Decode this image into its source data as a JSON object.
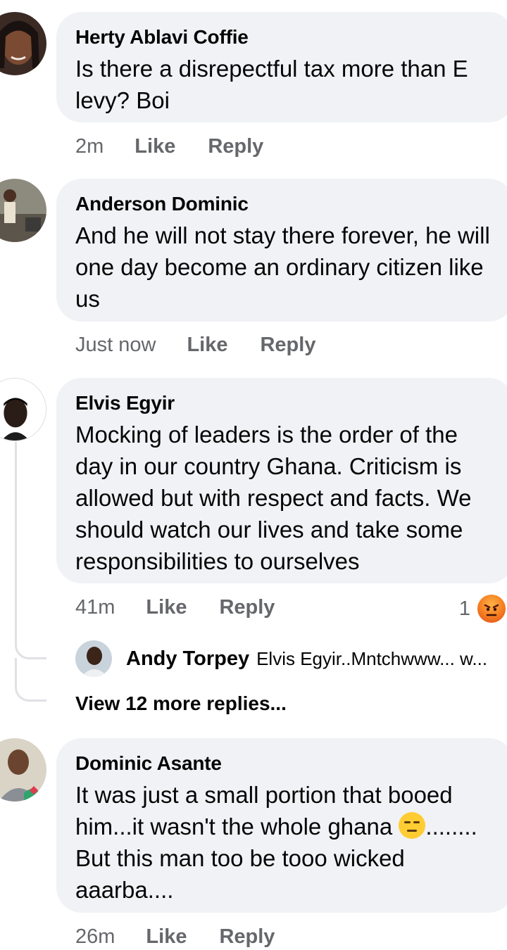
{
  "comments": [
    {
      "author": "Herty Ablavi Coffie",
      "text": "Is there a disrepectful tax more than E levy? Boi",
      "time": "2m",
      "like": "Like",
      "reply": "Reply"
    },
    {
      "author": "Anderson Dominic",
      "text": "And he will not stay there forever, he will one day become an ordinary citizen like us",
      "time": "Just now",
      "like": "Like",
      "reply": "Reply"
    },
    {
      "author": "Elvis Egyir",
      "text": "Mocking of leaders is the order of the day in our country Ghana. Criticism is allowed but with respect and facts. We should watch our lives and take some responsibilities to ourselves",
      "time": "41m",
      "like": "Like",
      "reply": "Reply",
      "reaction_count": "1",
      "reaction_icon": "angry-reaction-icon",
      "replies_preview": {
        "author": "Andy Torpey",
        "text": "Elvis Egyir..Mntchwww... w..."
      },
      "view_more": "View 12 more replies..."
    },
    {
      "author": "Dominic Asante",
      "text_part1": "It was just a small portion that booed him...it wasn't the whole ghana",
      "emoji": "expressionless-face-emoji",
      "text_part2": "........ But this man too be tooo wicked aaarba....",
      "time": "26m",
      "like": "Like",
      "reply": "Reply"
    }
  ],
  "colors": {
    "bubble": "#f0f2f5",
    "meta": "#65676b",
    "text": "#050505",
    "thread_line": "#dfe1e5"
  }
}
